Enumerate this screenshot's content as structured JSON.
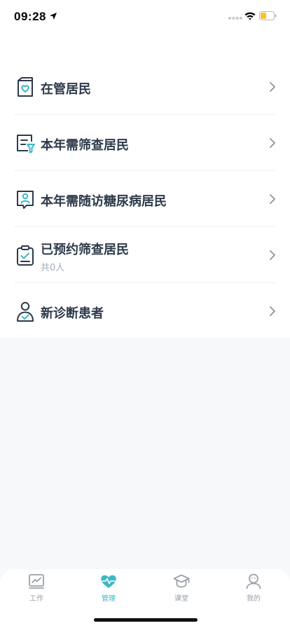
{
  "status_bar": {
    "time": "09:28",
    "icons": [
      "location-arrow-icon",
      "signal-icon",
      "wifi-icon",
      "battery-icon"
    ]
  },
  "list": {
    "items": [
      {
        "title": "在管居民",
        "icon": "resident-card-icon"
      },
      {
        "title": "本年需筛查居民",
        "icon": "screening-filter-icon"
      },
      {
        "title": "本年需随访糖尿病居民",
        "icon": "follow-up-user-icon"
      },
      {
        "title": "已预约筛查居民",
        "subtitle": "共0人",
        "icon": "clipboard-check-icon"
      },
      {
        "title": "新诊断患者",
        "icon": "new-patient-icon"
      }
    ]
  },
  "tab_bar": {
    "tabs": [
      {
        "label": "工作",
        "icon": "chart-icon",
        "active": false
      },
      {
        "label": "管理",
        "icon": "heart-pulse-icon",
        "active": true
      },
      {
        "label": "课堂",
        "icon": "graduation-cap-icon",
        "active": false
      },
      {
        "label": "我的",
        "icon": "user-icon",
        "active": false
      }
    ]
  },
  "colors": {
    "accent": "#3cb8c6",
    "text_primary": "#2d3a4a",
    "text_secondary": "#a3aab4",
    "background": "#f7f8fa",
    "battery_fill": "#f5c330"
  }
}
